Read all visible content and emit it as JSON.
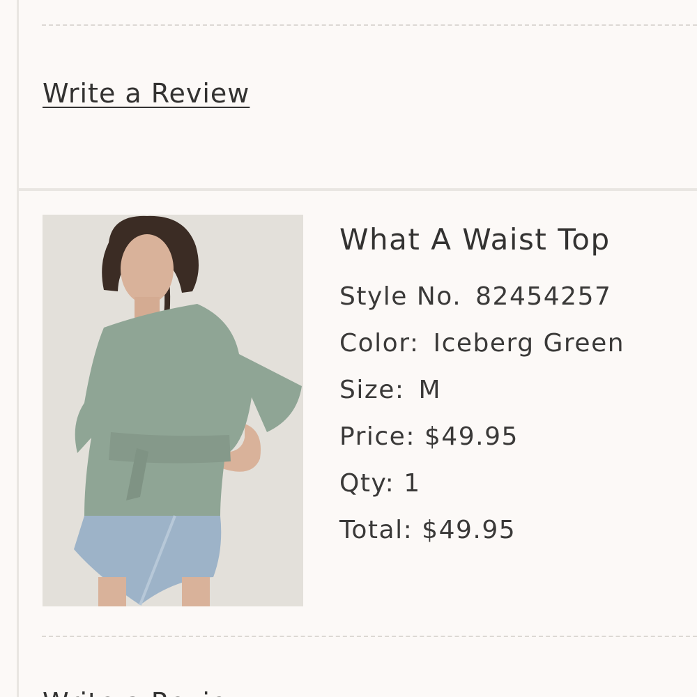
{
  "review_section": {
    "link_label": "Write a Review"
  },
  "product": {
    "title": "What A Waist Top",
    "style_label": "Style No.",
    "style_value": "82454257",
    "color_label": "Color:",
    "color_value": "Iceberg Green",
    "size_label": "Size:",
    "size_value": "M",
    "price_label": "Price:",
    "price_value": "$49.95",
    "qty_label": "Qty:",
    "qty_value": "1",
    "total_label": "Total:",
    "total_value": "$49.95",
    "image_colors": {
      "background": "#e6e3de",
      "top": "#8fa595",
      "denim": "#9db3c8",
      "skin": "#d9b29a",
      "hair": "#3b2c24"
    }
  },
  "next_review_section": {
    "link_label": "Write a Review"
  }
}
